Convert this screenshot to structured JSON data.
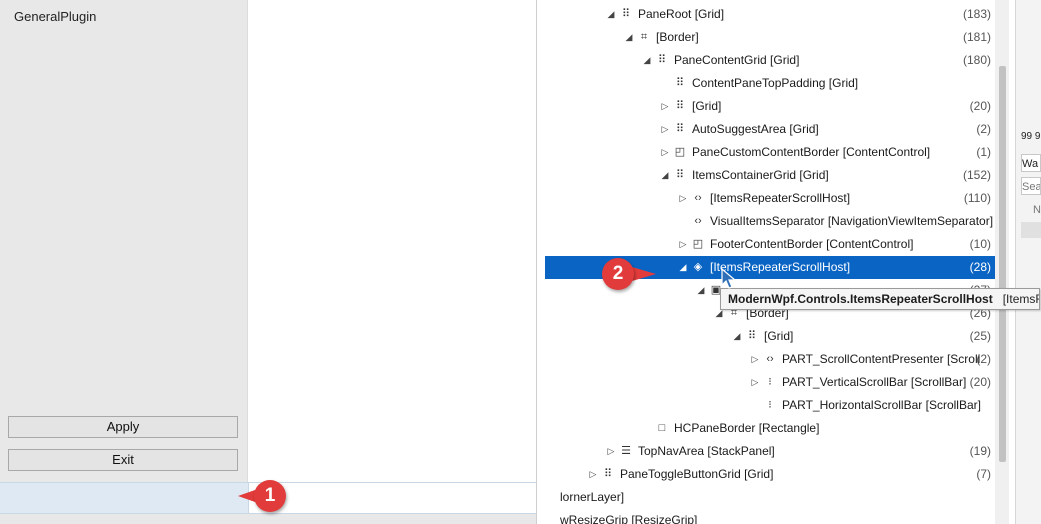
{
  "app": {
    "plugin_label": "GeneralPlugin",
    "apply_label": "Apply",
    "exit_label": "Exit"
  },
  "tree": {
    "rows": [
      {
        "label": "PaneRoot [Grid]",
        "count": "(183)",
        "expander": "◢",
        "icon": "grid-icon",
        "glyph": "⠿",
        "depth": 0
      },
      {
        "label": "[Border]",
        "count": "(181)",
        "expander": "◢",
        "icon": "border-icon",
        "glyph": "⌗",
        "depth": 1
      },
      {
        "label": "PaneContentGrid [Grid]",
        "count": "(180)",
        "expander": "◢",
        "icon": "grid-icon",
        "glyph": "⠿",
        "depth": 2
      },
      {
        "label": "ContentPaneTopPadding [Grid]",
        "count": "",
        "expander": "",
        "icon": "grid-icon",
        "glyph": "⠿",
        "depth": 3
      },
      {
        "label": "[Grid]",
        "count": "(20)",
        "expander": "▷",
        "icon": "grid-icon",
        "glyph": "⠿",
        "depth": 3
      },
      {
        "label": "AutoSuggestArea [Grid]",
        "count": "(2)",
        "expander": "▷",
        "icon": "grid-icon",
        "glyph": "⠿",
        "depth": 3
      },
      {
        "label": "PaneCustomContentBorder [ContentControl]",
        "count": "(1)",
        "expander": "▷",
        "icon": "content-control-icon",
        "glyph": "◰",
        "depth": 3
      },
      {
        "label": "ItemsContainerGrid [Grid]",
        "count": "(152)",
        "expander": "◢",
        "icon": "grid-icon",
        "glyph": "⠿",
        "depth": 3
      },
      {
        "label": "[ItemsRepeaterScrollHost]",
        "count": "(110)",
        "expander": "▷",
        "icon": "code-icon",
        "glyph": "‹›",
        "depth": 4
      },
      {
        "label": "VisualItemsSeparator [NavigationViewItemSeparator]",
        "count": "",
        "expander": "",
        "icon": "code-icon",
        "glyph": "‹›",
        "depth": 4
      },
      {
        "label": "FooterContentBorder [ContentControl]",
        "count": "(10)",
        "expander": "▷",
        "icon": "content-control-icon",
        "glyph": "◰",
        "depth": 4
      },
      {
        "label": "[ItemsRepeaterScrollHost]",
        "count": "(28)",
        "expander": "◢",
        "icon": "scroll-host-icon",
        "glyph": "◈",
        "depth": 4,
        "selected": true
      },
      {
        "label": "",
        "count": "(27)",
        "expander": "◢",
        "icon": "scroll-viewer-icon",
        "glyph": "▣",
        "depth": 5
      },
      {
        "label": "[Border]",
        "count": "(26)",
        "expander": "◢",
        "icon": "border-icon",
        "glyph": "⌗",
        "depth": 6
      },
      {
        "label": "[Grid]",
        "count": "(25)",
        "expander": "◢",
        "icon": "grid-icon",
        "glyph": "⠿",
        "depth": 7
      },
      {
        "label": "PART_ScrollContentPresenter [Scroll",
        "count": "(2)",
        "expander": "▷",
        "icon": "code-icon",
        "glyph": "‹›",
        "depth": 8
      },
      {
        "label": "PART_VerticalScrollBar [ScrollBar]",
        "count": "(20)",
        "expander": "▷",
        "icon": "scrollbar-icon",
        "glyph": "⁝",
        "depth": 8
      },
      {
        "label": "PART_HorizontalScrollBar [ScrollBar]",
        "count": "",
        "expander": "",
        "icon": "scrollbar-icon",
        "glyph": "⁝",
        "depth": 8
      },
      {
        "label": "HCPaneBorder [Rectangle]",
        "count": "",
        "expander": "",
        "icon": "rectangle-icon",
        "glyph": "□",
        "depth": 2
      },
      {
        "label": "TopNavArea [StackPanel]",
        "count": "(19)",
        "expander": "▷",
        "icon": "stackpanel-icon",
        "glyph": "☰",
        "depth": 0
      },
      {
        "label": "PaneToggleButtonGrid [Grid]",
        "count": "(7)",
        "expander": "▷",
        "icon": "grid-icon",
        "glyph": "⠿",
        "depth": -1
      },
      {
        "label": "lornerLayer]",
        "count": "",
        "expander": "",
        "icon": "",
        "glyph": "",
        "depth": -3
      },
      {
        "label": "wResizeGrip [ResizeGrip]",
        "count": "",
        "expander": "",
        "icon": "",
        "glyph": "",
        "depth": -3
      }
    ]
  },
  "tooltip": {
    "type": "ModernWpf.Controls.ItemsRepeaterScrollHost",
    "name": "[ItemsRe"
  },
  "right_strip": {
    "zoom": "99 9",
    "wa": "Wa",
    "search_placeholder": "Sea",
    "n": "N"
  },
  "markers": {
    "one": "1",
    "two": "2"
  },
  "colors": {
    "selection": "#0a64c4",
    "marker": "#e23b3b"
  }
}
